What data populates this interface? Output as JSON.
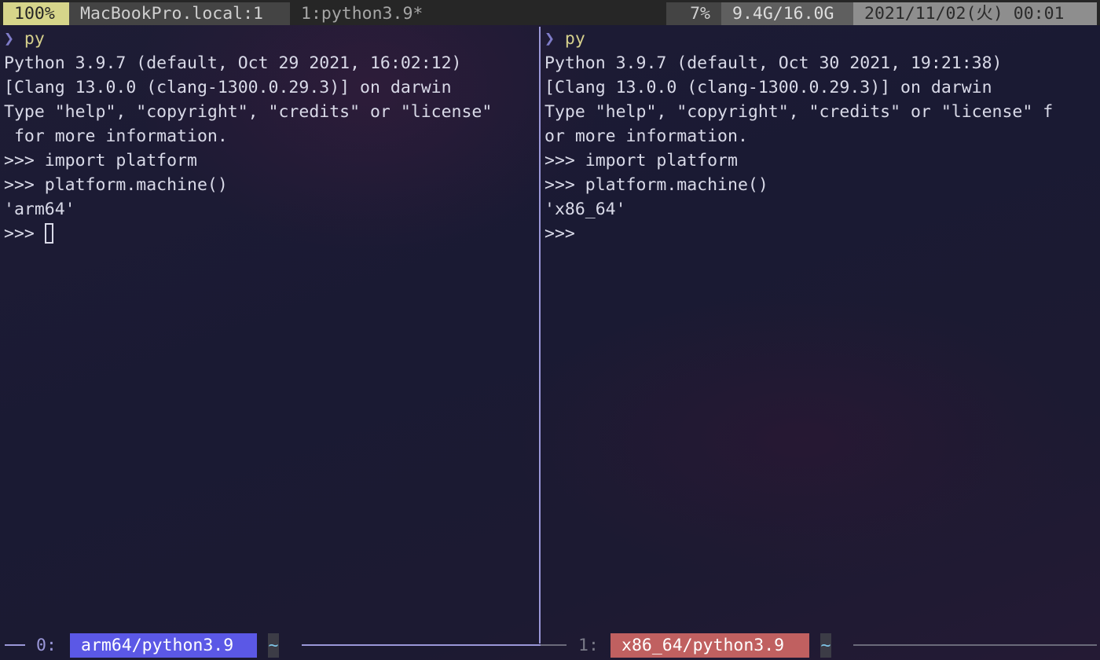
{
  "status_bar": {
    "battery": "100%",
    "host_session": "MacBookPro.local:1",
    "window": "1:python3.9*",
    "cpu": "7%",
    "memory": "9.4G/16.0G",
    "datetime": "2021/11/02(火) 00:01"
  },
  "left_pane": {
    "prompt_symbol": "❯",
    "command": "py",
    "lines": [
      "Python 3.9.7 (default, Oct 29 2021, 16:02:12)",
      "[Clang 13.0.0 (clang-1300.0.29.3)] on darwin",
      "Type \"help\", \"copyright\", \"credits\" or \"license\"",
      " for more information.",
      ">>> import platform",
      ">>> platform.machine()",
      "'arm64'"
    ],
    "current_prompt": ">>> ",
    "border_index": "0:",
    "border_title": "arm64/python3.9",
    "border_path": "~"
  },
  "right_pane": {
    "prompt_symbol": "❯",
    "command": "py",
    "lines": [
      "Python 3.9.7 (default, Oct 30 2021, 19:21:38)",
      "[Clang 13.0.0 (clang-1300.0.29.3)] on darwin",
      "Type \"help\", \"copyright\", \"credits\" or \"license\" f",
      "or more information.",
      ">>> import platform",
      ">>> platform.machine()",
      "'x86_64'"
    ],
    "current_prompt": ">>>",
    "border_index": "1:",
    "border_title": "x86_64/python3.9",
    "border_path": "~"
  },
  "colors": {
    "active_pane_border": "#9a97d8",
    "left_title_bg": "#5b58e6",
    "right_title_bg": "#c06060",
    "battery_bg": "#d6d58a"
  }
}
